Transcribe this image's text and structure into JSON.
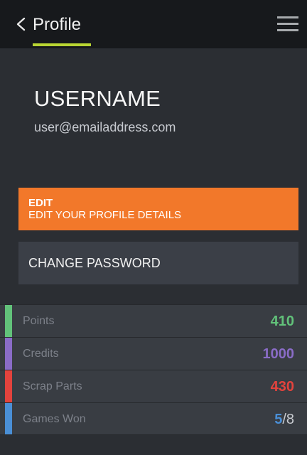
{
  "header": {
    "back_icon": "chevron-left-icon",
    "title": "Profile",
    "menu_icon": "hamburger-menu-icon",
    "accent_color": "#b9d533"
  },
  "profile": {
    "username": "USERNAME",
    "email": "user@emailaddress.com"
  },
  "actions": {
    "edit_title": "EDIT",
    "edit_subtitle": "EDIT YOUR PROFILE DETAILS",
    "edit_color": "#f2782a",
    "change_password": "CHANGE PASSWORD"
  },
  "stats": [
    {
      "label": "Points",
      "value": "410",
      "color": "#62c27a"
    },
    {
      "label": "Credits",
      "value": "1000",
      "color": "#8a6cc7"
    },
    {
      "label": "Scrap Parts",
      "value": "430",
      "color": "#e3433d"
    },
    {
      "label": "Games Won",
      "value": "5",
      "value_total": "/8",
      "color": "#4a8fd6"
    }
  ]
}
